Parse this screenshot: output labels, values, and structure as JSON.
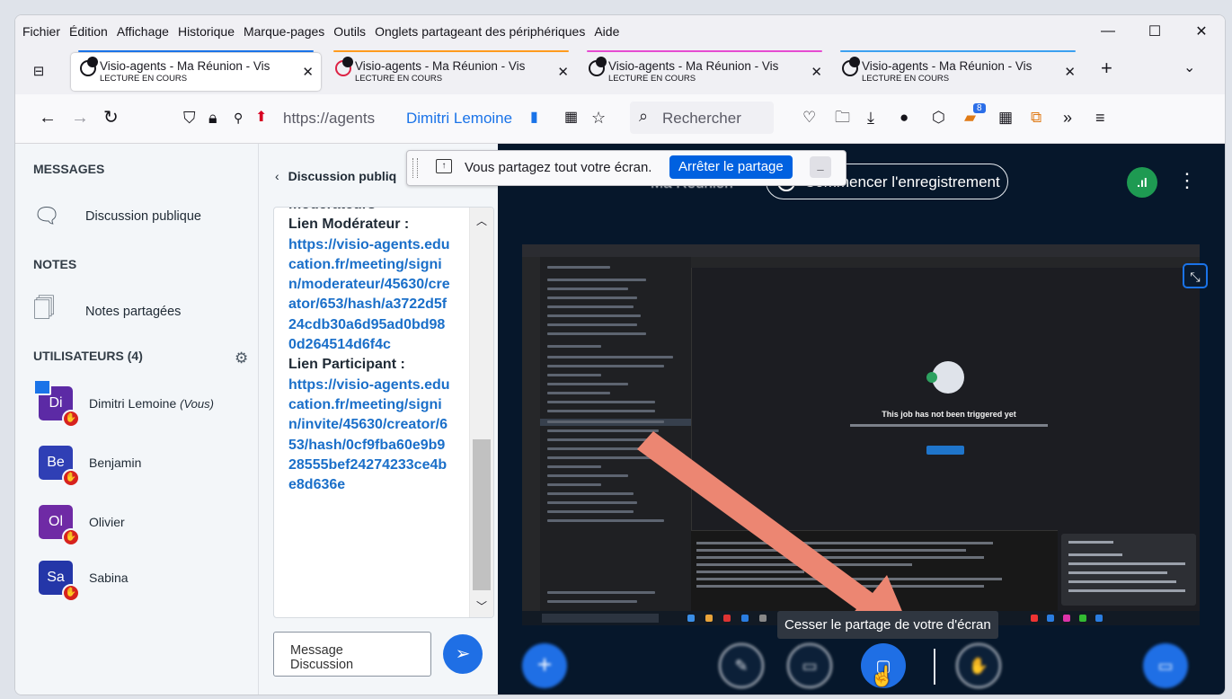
{
  "menubar": {
    "items": [
      "Fichier",
      "Édition",
      "Affichage",
      "Historique",
      "Marque-pages",
      "Outils",
      "Onglets partageant des périphériques",
      "Aide"
    ]
  },
  "tabs": [
    {
      "title": "Visio-agents - Ma Réunion - Vis",
      "subtitle": "LECTURE EN COURS",
      "color": "#1a73e8",
      "active": true
    },
    {
      "title": "Visio-agents - Ma Réunion - Vis",
      "subtitle": "LECTURE EN COURS",
      "color": "#ff9b1e",
      "active": false
    },
    {
      "title": "Visio-agents - Ma Réunion - Vis",
      "subtitle": "LECTURE EN COURS",
      "color": "#e64bd1",
      "active": false
    },
    {
      "title": "Visio-agents - Ma Réunion - Vis",
      "subtitle": "LECTURE EN COURS",
      "color": "#3ba0f0",
      "active": false
    }
  ],
  "navbar": {
    "url": "https://agents",
    "sharing_name": "Dimitri Lemoine",
    "search_placeholder": "Rechercher",
    "extension_badge": "8"
  },
  "share_banner": {
    "message": "Vous partagez tout votre écran.",
    "stop_label": "Arrêter le partage"
  },
  "sidebar": {
    "messages_heading": "MESSAGES",
    "public_chat": "Discussion publique",
    "notes_heading": "NOTES",
    "shared_notes": "Notes partagées",
    "users_heading": "UTILISATEURS (4)",
    "users": [
      {
        "initials": "Di",
        "name": "Dimitri Lemoine",
        "suffix": "(Vous)",
        "color": "#5c2aa5"
      },
      {
        "initials": "Be",
        "name": "Benjamin",
        "suffix": "",
        "color": "#2f3fb5"
      },
      {
        "initials": "Ol",
        "name": "Olivier",
        "suffix": "",
        "color": "#6f2aa5"
      },
      {
        "initials": "Sa",
        "name": "Sabina",
        "suffix": "",
        "color": "#2436a8"
      }
    ]
  },
  "chat": {
    "header": "Discussion publiq",
    "top_word": "modérateurs",
    "moderator_label": "Lien Modérateur :",
    "moderator_link": "https://visio-agents.education.fr/meeting/signin/moderateur/45630/creator/653/hash/a3722d5f24cdb30a6d95ad0bd980d264514d6f4c",
    "participant_label": "Lien Participant :",
    "participant_link": "https://visio-agents.education.fr/meeting/signin/invite/45630/creator/653/hash/0cf9fba60e9b928555bef24274233ce4be8d636e",
    "input_placeholder": "Message Discussion"
  },
  "meeting": {
    "title": "Ma Réunion",
    "record_label": "Commencer l'enregistrement",
    "tooltip": "Cesser le partage de votre d'écran",
    "shared_screen": {
      "job_title": "This job has not been triggered yet"
    }
  }
}
